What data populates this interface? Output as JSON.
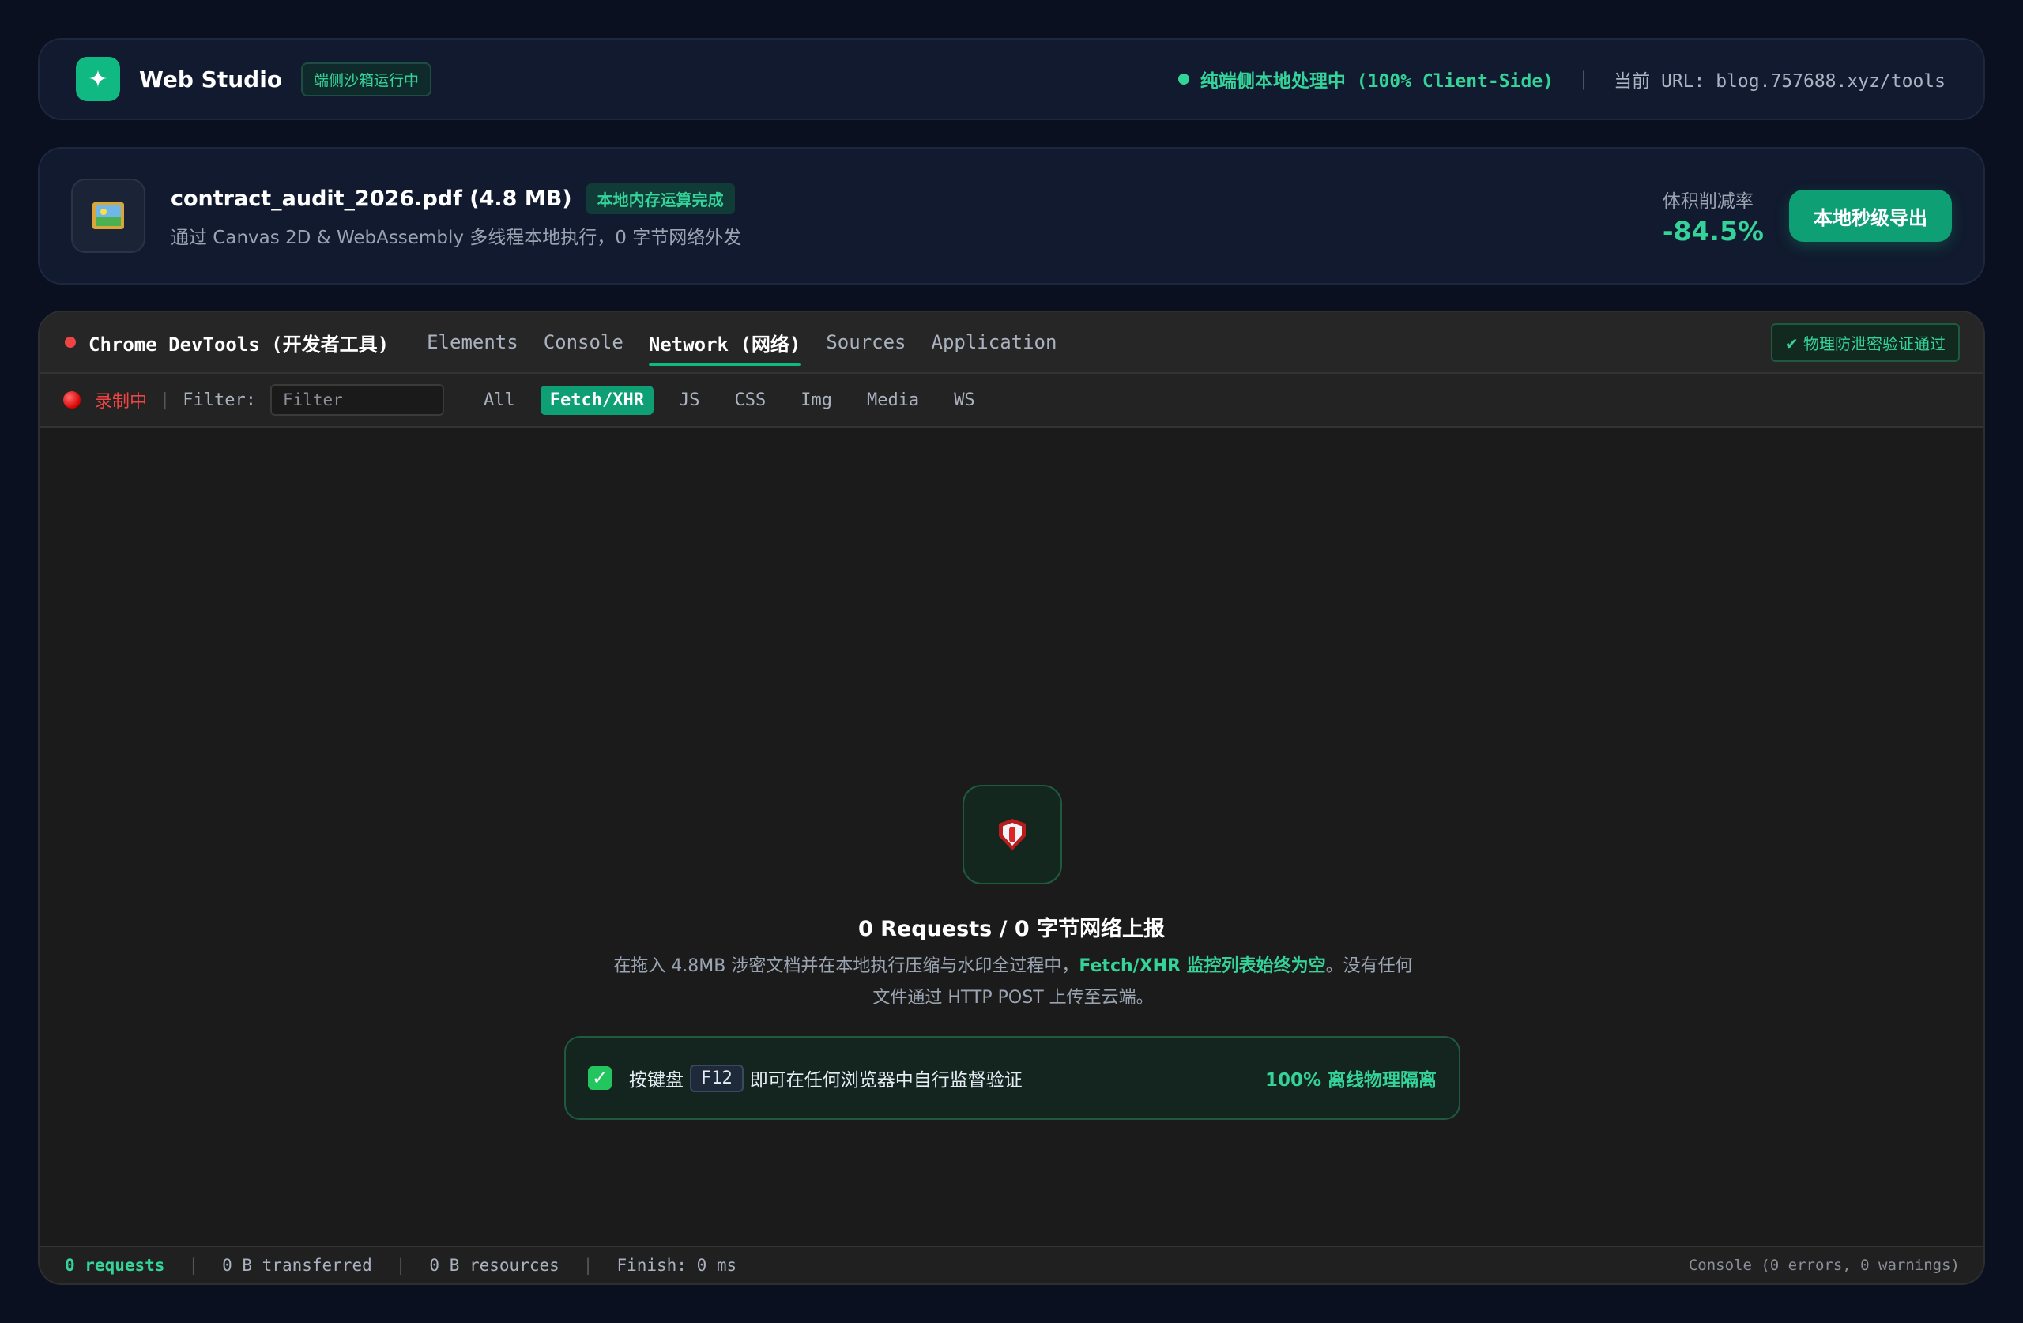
{
  "header": {
    "logo_glyph": "✦",
    "brand": "Web Studio",
    "sandbox_badge": "端侧沙箱运行中",
    "status_text": "纯端侧本地处理中 (100% Client-Side)",
    "separator": "|",
    "url_label": "当前 URL: blog.757688.xyz/tools"
  },
  "file_card": {
    "icon": "image-file-icon",
    "file_name": "contract_audit_2026.pdf (4.8 MB)",
    "status_badge": "本地内存运算完成",
    "description": "通过 Canvas 2D & WebAssembly 多线程本地执行，0 字节网络外发",
    "reduction_label": "体积削减率",
    "reduction_value": "-84.5%",
    "export_button": "本地秒级导出"
  },
  "devtools": {
    "title": "Chrome DevTools (开发者工具)",
    "tabs": [
      {
        "label": "Elements",
        "active": false
      },
      {
        "label": "Console",
        "active": false
      },
      {
        "label": "Network (网络)",
        "active": true
      },
      {
        "label": "Sources",
        "active": false
      },
      {
        "label": "Application",
        "active": false
      }
    ],
    "verify_badge": "✔ 物理防泄密验证通过",
    "toolbar": {
      "recording": "录制中",
      "sep": "|",
      "filter_label": "Filter:",
      "filter_placeholder": "Filter",
      "types": [
        {
          "label": "All",
          "active": false
        },
        {
          "label": "Fetch/XHR",
          "active": true
        },
        {
          "label": "JS",
          "active": false
        },
        {
          "label": "CSS",
          "active": false
        },
        {
          "label": "Img",
          "active": false
        },
        {
          "label": "Media",
          "active": false
        },
        {
          "label": "WS",
          "active": false
        }
      ]
    },
    "empty_state": {
      "icon": "shield-icon",
      "title": "0 Requests / 0 字节网络上报",
      "desc_before": "在拖入 4.8MB 涉密文档并在本地执行压缩与水印全过程中，",
      "desc_highlight": "Fetch/XHR 监控列表始终为空",
      "desc_after": "。没有任何文件通过 HTTP POST 上传至云端。"
    },
    "hint": {
      "check_glyph": "✓",
      "before": "按键盘",
      "key": "F12",
      "after": "即可在任何浏览器中自行监督验证",
      "right": "100% 离线物理隔离"
    },
    "footer": {
      "requests": "0 requests",
      "transferred": "0 B transferred",
      "resources": "0 B resources",
      "finish": "Finish: 0 ms",
      "sep": "|",
      "console_status": "Console (0 errors, 0 warnings)"
    }
  },
  "colors": {
    "accent": "#10b981",
    "accent_text": "#34d399",
    "page_bg": "#0b1020",
    "devtools_bg": "#1b1b1b",
    "recording_red": "#ef4444"
  }
}
